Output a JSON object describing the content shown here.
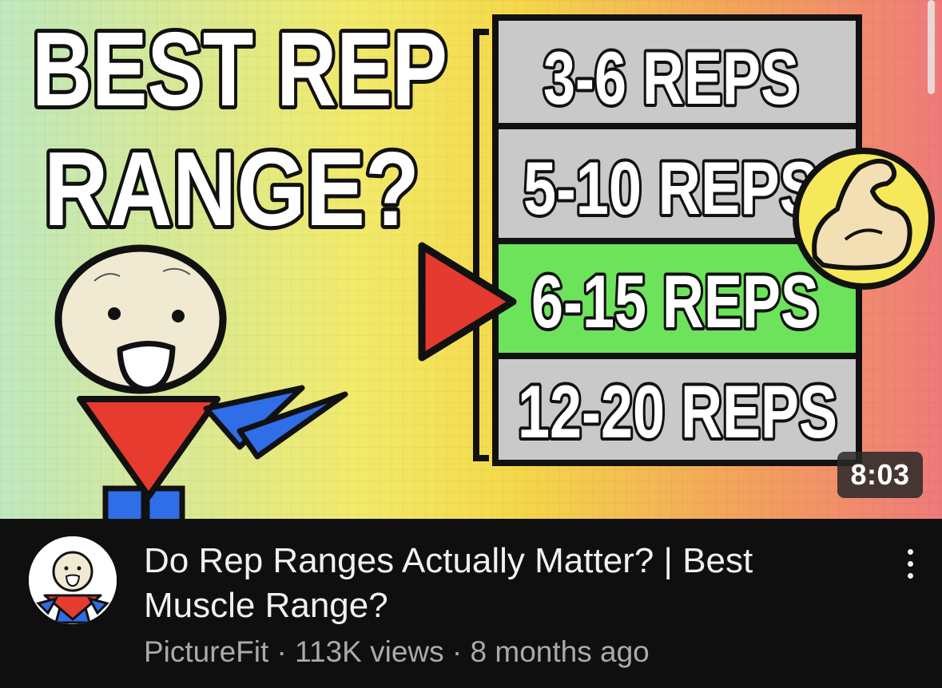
{
  "thumbnail": {
    "headline_line1": "BEST REP",
    "headline_line2": "RANGE?",
    "rep_options": [
      "3-6 REPS",
      "5-10 REPS",
      "6-15 REPS",
      "12-20 REPS"
    ],
    "highlighted_option_index": 2,
    "duration": "8:03",
    "colors": {
      "gradient_left": "#bfe8bf",
      "gradient_mid": "#f4e04a",
      "gradient_right": "#ef7a7a",
      "highlight_green": "#6ce35b",
      "option_gray": "#c9c9c9",
      "pointer_red": "#e43a2f",
      "shirt_red": "#e63b2e",
      "arm_blue": "#2f6ee6"
    }
  },
  "video": {
    "title": "Do Rep Ranges Actually Matter? | Best Muscle Range?",
    "channel": "PictureFit",
    "views": "113K views",
    "age": "8 months ago",
    "separator": "·"
  },
  "icons": {
    "menu": "more-vert-icon",
    "avatar": "channel-avatar",
    "muscle": "flexed-bicep-icon",
    "pointer": "play-triangle-icon"
  }
}
